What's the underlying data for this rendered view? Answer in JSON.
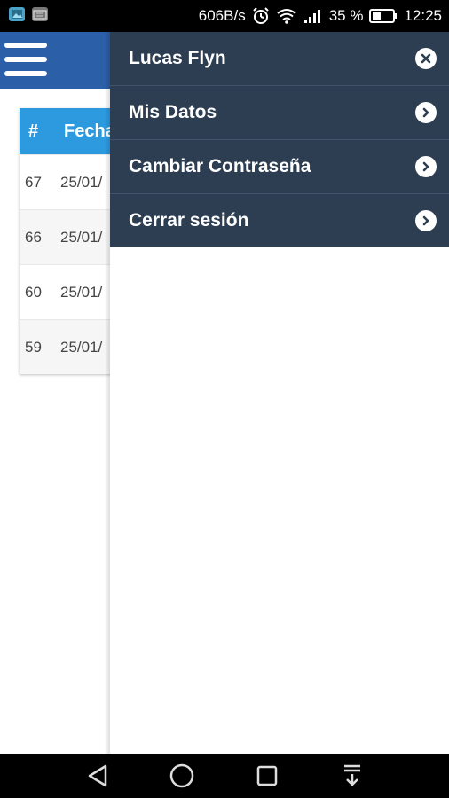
{
  "status_bar": {
    "speed": "606B/s",
    "battery": "35 %",
    "time": "12:25",
    "icons": [
      "gallery-icon",
      "keyboard-icon",
      "alarm-icon",
      "wifi-icon",
      "signal-icon",
      "battery-icon"
    ]
  },
  "appbar": {
    "color": "#2b5fa8",
    "menu_icon": "hamburger-menu-icon"
  },
  "table": {
    "header_color": "#2d9ae0",
    "headers": [
      "#",
      "Fecha"
    ],
    "rows": [
      {
        "num": "67",
        "date": "25/01/"
      },
      {
        "num": "66",
        "date": "25/01/"
      },
      {
        "num": "60",
        "date": "25/01/"
      },
      {
        "num": "59",
        "date": "25/01/"
      }
    ]
  },
  "drawer": {
    "background": "#2d3e52",
    "items": [
      {
        "label": "Lucas Flyn",
        "icon": "close-circle-icon"
      },
      {
        "label": "Mis Datos",
        "icon": "chevron-right-circle-icon"
      },
      {
        "label": "Cambiar Contraseña",
        "icon": "chevron-right-circle-icon"
      },
      {
        "label": "Cerrar sesión",
        "icon": "chevron-right-circle-icon"
      }
    ]
  },
  "navbar": {
    "icons": [
      "back-triangle-icon",
      "home-circle-icon",
      "recents-square-icon",
      "notification-pull-icon"
    ]
  }
}
